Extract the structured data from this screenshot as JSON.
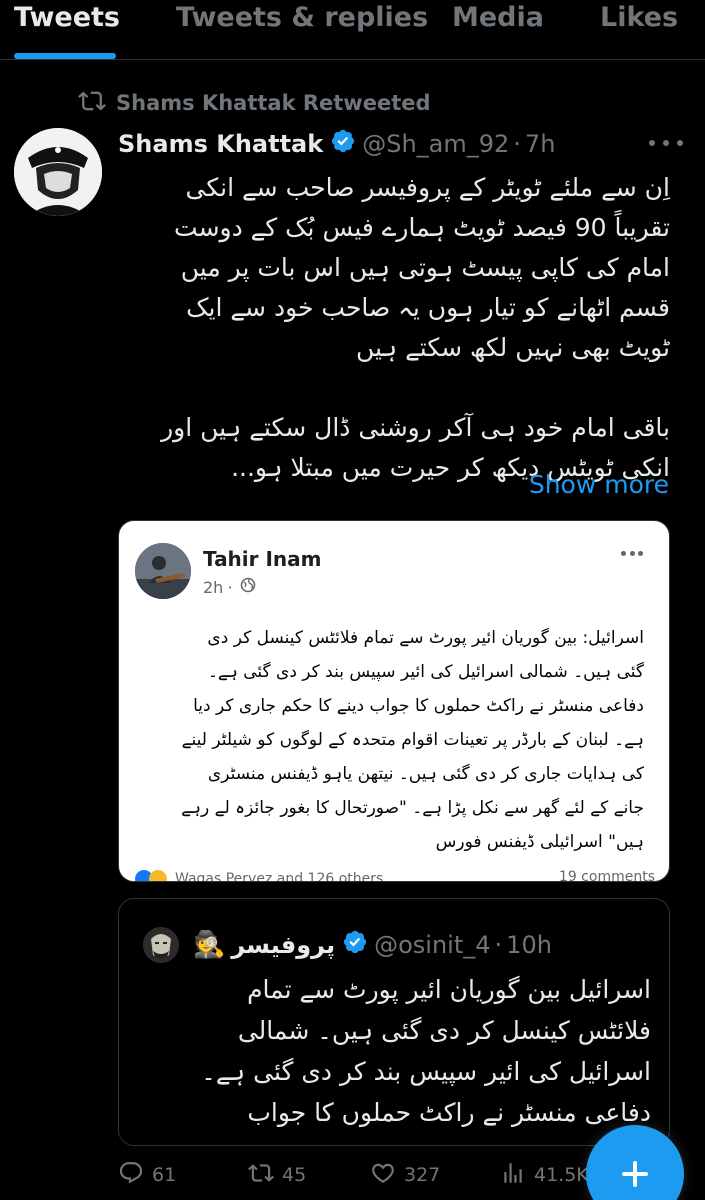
{
  "tabs": [
    {
      "label": "Tweets",
      "active": true
    },
    {
      "label": "Tweets & replies",
      "active": false
    },
    {
      "label": "Media",
      "active": false
    },
    {
      "label": "Likes",
      "active": false
    }
  ],
  "retweet": {
    "icon": "retweet-icon",
    "text": "Shams Khattak Retweeted"
  },
  "tweet": {
    "name": "Shams Khattak",
    "verified": true,
    "handle": "@Sh_am_92",
    "separator": "·",
    "time": "7h",
    "body_lines": [
      "اِن سے ملئے ٹویٹر کے پروفیسر صاحب سے انکی",
      "تقریباً 90 فیصد ٹویٹ ہمارے فیس بُک کے دوست",
      "امام کی کاپی پیسٹ ہوتی ہیں اس بات پر میں",
      "قسم اٹھانے کو تیار ہوں یہ صاحب خود سے ایک",
      "ٹویٹ بھی نہیں لکھ سکتے ہیں",
      "",
      "باقی امام خود ہی آکر روشنی ڈال سکتے ہیں اور",
      "انکی ٹویٹس دیکھ کر حیرت میں مبتلا ہو..."
    ],
    "show_more": "Show more"
  },
  "image_card": {
    "fb_name": "Tahir Inam",
    "fb_time": "2h",
    "fb_separator": "·",
    "fb_text_lines": [
      "اسرائیل: بین گوریان ائیر پورٹ سے تمام فلائٹس کینسل کر دی",
      "گئی ہیں۔ شمالی اسرائیل کی ائیر سپیس بند کر دی گئی ہے۔",
      "دفاعی منسٹر نے راکٹ حملوں کا جواب دینے کا حکم جاری کر دیا",
      "ہے۔ لبنان کے بارڈر پر تعینات اقوام متحدہ کے لوگوں کو شیلٹر لینے",
      "کی ہدایات جاری کر دی گئی ہیں۔ نیتھن یاہو ڈیفنس منسٹری",
      "جانے کے لئے گھر سے نکل پڑا ہے۔ \"صورتحال کا بغور جائزہ لے رہے",
      "ہیں\" اسرائیلی ڈیفنس فورس"
    ],
    "fb_footer_left": "Waqas Pervez and 126 others",
    "fb_footer_right": "19 comments"
  },
  "quote": {
    "emoji": "🕵",
    "name": "پروفیسر",
    "verified": true,
    "handle": "@osinit_4",
    "separator": "·",
    "time": "10h",
    "body_lines": [
      "اسرائیل بین گوریان ائیر پورٹ سے تمام",
      "فلائٹس کینسل کر دی گئی ہیں۔ شمالی",
      "اسرائیل کی ائیر سپیس بند کر دی گئی ہے۔",
      "دفاعی منسٹر نے راکٹ حملوں کا جواب"
    ]
  },
  "actions": {
    "replies": "61",
    "retweets": "45",
    "likes": "327",
    "views": "41.5K"
  },
  "colors": {
    "background": "#000000",
    "text": "#e7e9ea",
    "secondary": "#71767b",
    "accent": "#1d9bf0",
    "border": "#2f3336"
  }
}
